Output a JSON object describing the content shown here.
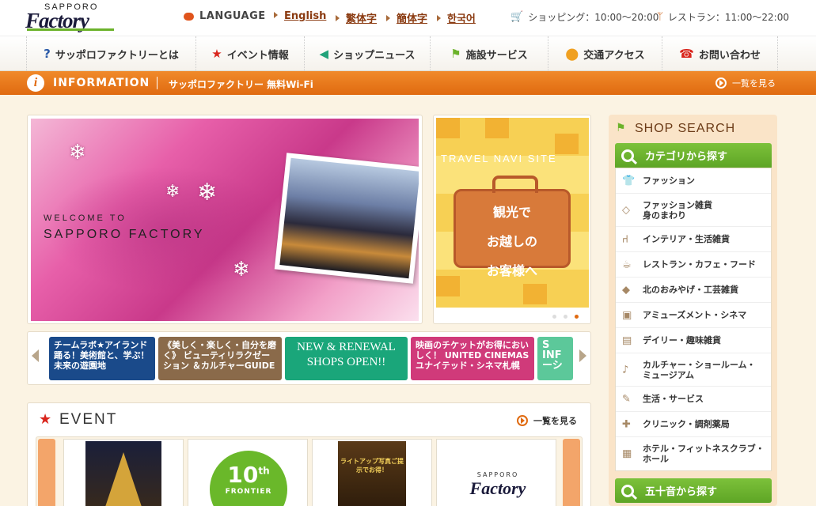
{
  "header": {
    "logo_top": "SAPPORO",
    "logo_main": "Factory",
    "language_label": "LANGUAGE",
    "languages": [
      "English",
      "繁体字",
      "簡体字",
      "한국어"
    ],
    "shopping_hours": "ショッピング：10:00～20:00",
    "restaurant_hours": "レストラン：11:00～22:00"
  },
  "nav": {
    "items": [
      {
        "label": "サッポロファクトリーとは",
        "icon": "question-icon"
      },
      {
        "label": "イベント情報",
        "icon": "star-icon"
      },
      {
        "label": "ショップニュース",
        "icon": "megaphone-icon"
      },
      {
        "label": "施設サービス",
        "icon": "flag-icon"
      },
      {
        "label": "交通アクセス",
        "icon": "map-pin-icon"
      },
      {
        "label": "お問い合わせ",
        "icon": "phone-icon"
      }
    ]
  },
  "info": {
    "title": "INFORMATION",
    "text": "サッポロファクトリー 無料Wi-Fi",
    "more": "一覧を見る"
  },
  "hero": {
    "welcome": "WELCOME TO",
    "title": "SAPPORO FACTORY"
  },
  "travel": {
    "heading": "TRAVEL NAVI SITE",
    "lines": [
      "観光で",
      "お越しの",
      "お客様へ"
    ]
  },
  "banners": [
    {
      "text": "チームラボ★アイランド 踊る！美術館と、学ぶ！未来の遊園地",
      "color": "#1a4a8a"
    },
    {
      "text": "《美しく・楽しく・自分を磨く》 ビューティリラクゼーション ＆カルチャーGUIDE",
      "color": "#8a6a4a"
    },
    {
      "text": "NEW & RENEWAL SHOPS OPEN!!",
      "color": "#1aa67a"
    },
    {
      "text": "映画のチケットがお得においしく！ UNITED CINEMAS ユナイテッド・シネマ札幌",
      "color": "#d03a7a"
    },
    {
      "text": "S INF ーシ",
      "color": "#5cc89a"
    }
  ],
  "event": {
    "title": "EVENT",
    "more": "一覧を見る",
    "cards": [
      {
        "label": ""
      },
      {
        "label": "10th FRONTIER"
      },
      {
        "label": "ライトアップ写真ご提示でお得！"
      },
      {
        "label": "SAPPORO Factory"
      }
    ]
  },
  "shop": {
    "title": "SHOP SEARCH",
    "category_header": "カテゴリから探す",
    "kana_header": "五十音から探す",
    "categories": [
      {
        "label": "ファッション",
        "icon": "shirt-icon"
      },
      {
        "label": "ファッション雑貨\n身のまわり",
        "icon": "diamond-icon"
      },
      {
        "label": "インテリア・生活雑貨",
        "icon": "chair-icon"
      },
      {
        "label": "レストラン・カフェ・フード",
        "icon": "cup-icon"
      },
      {
        "label": "北のおみやげ・工芸雑貨",
        "icon": "hokkaido-icon"
      },
      {
        "label": "アミューズメント・シネマ",
        "icon": "camera-icon"
      },
      {
        "label": "デイリー・趣味雑貨",
        "icon": "basket-icon"
      },
      {
        "label": "カルチャー・ショールーム・\nミュージアム",
        "icon": "music-icon"
      },
      {
        "label": "生活・サービス",
        "icon": "service-icon"
      },
      {
        "label": "クリニック・調剤薬局",
        "icon": "cross-icon"
      },
      {
        "label": "ホテル・フィットネスクラブ・\nホール",
        "icon": "hotel-icon"
      }
    ]
  }
}
